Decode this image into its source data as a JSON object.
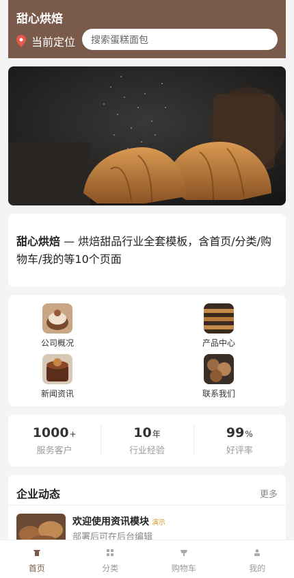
{
  "header": {
    "brand": "甜心烘焙",
    "location_label": "当前定位",
    "search_placeholder": "搜索蛋糕面包",
    "bg_color": "#7a5a4a"
  },
  "intro": {
    "brand": "甜心烘焙",
    "text": " — 烘焙甜品行业全套模板，含首页/分类/购物车/我的等10个页面"
  },
  "grid": [
    {
      "label": "公司概况"
    },
    {
      "label": "产品中心"
    },
    {
      "label": "新闻资讯"
    },
    {
      "label": "联系我们"
    }
  ],
  "stats": [
    {
      "value": "1000",
      "unit": "+",
      "label": "服务客户"
    },
    {
      "value": "10",
      "unit": "年",
      "label": "行业经验"
    },
    {
      "value": "99",
      "unit": "%",
      "label": "好评率"
    }
  ],
  "news": {
    "title": "企业动态",
    "more": "更多",
    "item": {
      "title": "欢迎使用资讯模块",
      "tag": "演示",
      "subtitle": "部署后可在后台编辑"
    }
  },
  "tabs": [
    {
      "label": "首页",
      "icon": "home-icon",
      "active": true
    },
    {
      "label": "分类",
      "icon": "grid-icon",
      "active": false
    },
    {
      "label": "购物车",
      "icon": "cart-icon",
      "active": false
    },
    {
      "label": "我的",
      "icon": "user-icon",
      "active": false
    }
  ]
}
